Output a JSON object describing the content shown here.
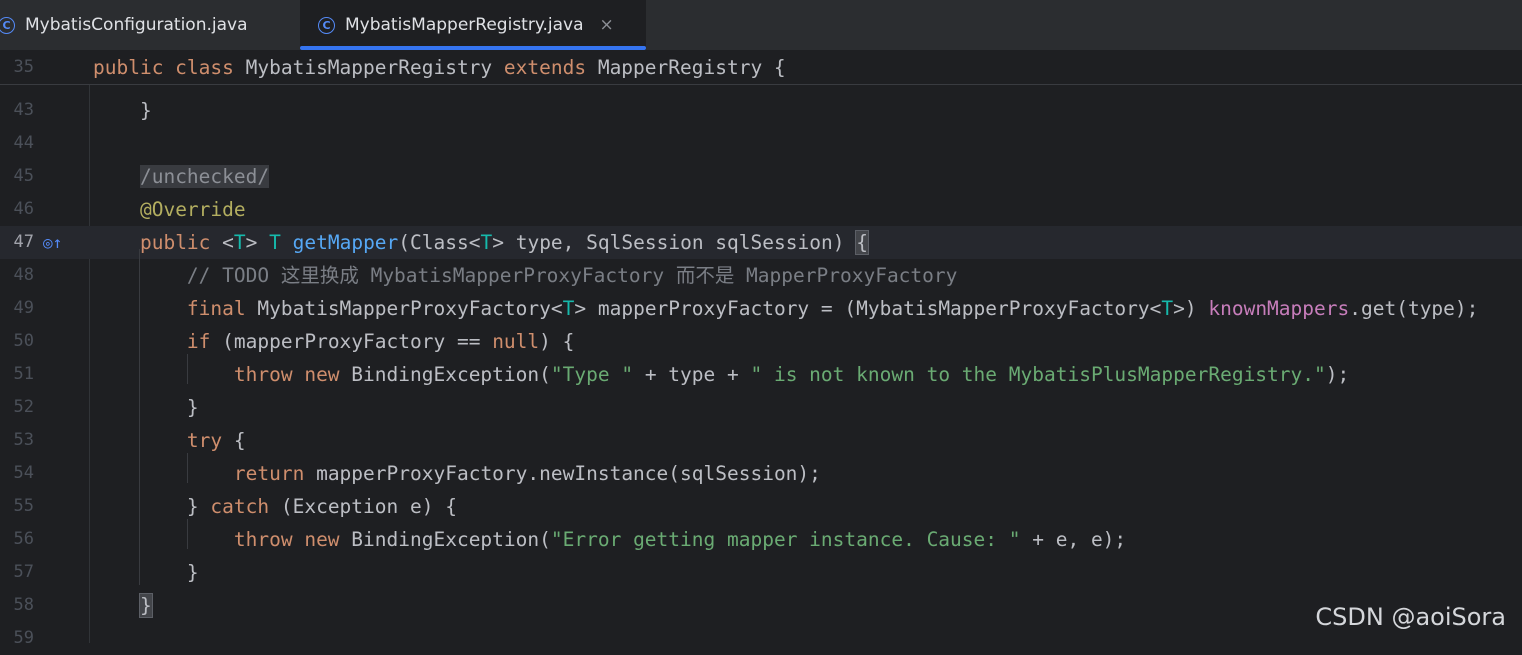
{
  "tabs": [
    {
      "label": "MybatisConfiguration.java",
      "icon": "java-class-icon",
      "active": false
    },
    {
      "label": "MybatisMapperRegistry.java",
      "icon": "java-class-icon",
      "active": true
    }
  ],
  "class_icon_glyph": "C",
  "close_glyph": "×",
  "gutter_icon_glyph": "◎↑",
  "lines": [
    {
      "num": "35",
      "t": [
        [
          "kw",
          "public class "
        ],
        [
          "pl",
          "MybatisMapperRegistry "
        ],
        [
          "kw",
          "extends "
        ],
        [
          "pl",
          "MapperRegistry {"
        ]
      ]
    },
    {
      "num": "43",
      "t": [
        [
          "pl",
          "    }"
        ]
      ]
    },
    {
      "num": "44",
      "t": []
    },
    {
      "num": "45",
      "t": [
        [
          "pl",
          "    "
        ],
        [
          "fold",
          "/unchecked/"
        ]
      ]
    },
    {
      "num": "46",
      "t": [
        [
          "pl",
          "    "
        ],
        [
          "an",
          "@Override"
        ]
      ]
    },
    {
      "num": "47",
      "t": [
        [
          "pl",
          "    "
        ],
        [
          "kw",
          "public "
        ],
        [
          "pl",
          "<"
        ],
        [
          "ty",
          "T"
        ],
        [
          "pl",
          "> "
        ],
        [
          "ty",
          "T "
        ],
        [
          "fn",
          "getMapper"
        ],
        [
          "pl",
          "(Class<"
        ],
        [
          "ty",
          "T"
        ],
        [
          "pl",
          "> type, SqlSession sqlSession) "
        ],
        [
          "bh",
          "{"
        ]
      ]
    },
    {
      "num": "48",
      "t": [
        [
          "pl",
          "        "
        ],
        [
          "cm",
          "// TODO 这里换成 MybatisMapperProxyFactory 而不是 MapperProxyFactory"
        ]
      ]
    },
    {
      "num": "49",
      "t": [
        [
          "pl",
          "        "
        ],
        [
          "kw",
          "final "
        ],
        [
          "pl",
          "MybatisMapperProxyFactory<"
        ],
        [
          "ty",
          "T"
        ],
        [
          "pl",
          "> mapperProxyFactory = (MybatisMapperProxyFactory<"
        ],
        [
          "ty",
          "T"
        ],
        [
          "pl",
          ">) "
        ],
        [
          "fd",
          "knownMappers"
        ],
        [
          "pl",
          ".get(type);"
        ]
      ]
    },
    {
      "num": "50",
      "t": [
        [
          "pl",
          "        "
        ],
        [
          "kw",
          "if "
        ],
        [
          "pl",
          "(mapperProxyFactory == "
        ],
        [
          "kw",
          "null"
        ],
        [
          "pl",
          ") {"
        ]
      ]
    },
    {
      "num": "51",
      "t": [
        [
          "pl",
          "            "
        ],
        [
          "kw",
          "throw new "
        ],
        [
          "pl",
          "BindingException("
        ],
        [
          "st",
          "\"Type \""
        ],
        [
          "pl",
          " + type + "
        ],
        [
          "st",
          "\" is not known to the MybatisPlusMapperRegistry.\""
        ],
        [
          "pl",
          ");"
        ]
      ]
    },
    {
      "num": "52",
      "t": [
        [
          "pl",
          "        }"
        ]
      ]
    },
    {
      "num": "53",
      "t": [
        [
          "pl",
          "        "
        ],
        [
          "kw",
          "try "
        ],
        [
          "pl",
          "{"
        ]
      ]
    },
    {
      "num": "54",
      "t": [
        [
          "pl",
          "            "
        ],
        [
          "kw",
          "return "
        ],
        [
          "pl",
          "mapperProxyFactory.newInstance(sqlSession);"
        ]
      ]
    },
    {
      "num": "55",
      "t": [
        [
          "pl",
          "        } "
        ],
        [
          "kw",
          "catch "
        ],
        [
          "pl",
          "(Exception e) {"
        ]
      ]
    },
    {
      "num": "56",
      "t": [
        [
          "pl",
          "            "
        ],
        [
          "kw",
          "throw new "
        ],
        [
          "pl",
          "BindingException("
        ],
        [
          "st",
          "\"Error getting mapper instance. Cause: \""
        ],
        [
          "pl",
          " + e, e);"
        ]
      ]
    },
    {
      "num": "57",
      "t": [
        [
          "pl",
          "        }"
        ]
      ]
    },
    {
      "num": "58",
      "t": [
        [
          "pl",
          "    "
        ],
        [
          "bh",
          "}"
        ]
      ]
    },
    {
      "num": "59",
      "t": []
    }
  ],
  "watermark": "CSDN @aoiSora",
  "colors": {
    "accent": "#3574f0",
    "background": "#1e1f22",
    "keyword": "#cf8e6d",
    "string": "#6aab73",
    "method": "#56a8f5"
  }
}
